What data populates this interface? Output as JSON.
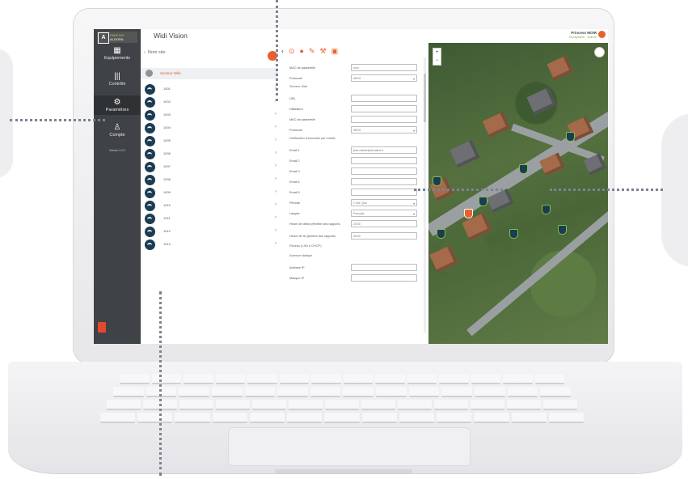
{
  "app": {
    "logo_mark": "A",
    "logo_line1": "PARKING",
    "logo_line2": "ALGORA",
    "title": "Widi Vision",
    "user_name": "Princess MOIR",
    "user_sub": "Infosystem · Admin",
    "version": "Version 2.0.2"
  },
  "nav": [
    {
      "label": "Equipements",
      "icon": "building-icon"
    },
    {
      "label": "Contrôle",
      "icon": "barcode-icon"
    },
    {
      "label": "Paramètres",
      "icon": "gear-icon"
    },
    {
      "label": "Compte",
      "icon": "user-icon"
    }
  ],
  "list": {
    "header": "Nom site",
    "group": "Secteur Wife",
    "items": [
      "1001",
      "1002",
      "1003",
      "1004",
      "1005",
      "1006",
      "1007",
      "1008",
      "1009",
      "1010",
      "1011",
      "1012",
      "1013"
    ]
  },
  "toolbar": [
    "‹",
    "⊙",
    "●",
    "✎",
    "⚒",
    "▣"
  ],
  "form": {
    "rows": [
      {
        "label": "MAC de passerelle",
        "value": "xxxx"
      },
      {
        "label": "Protocole",
        "value": "WISO",
        "select": true
      },
      {
        "section": "Serveur Web"
      },
      {
        "label": "URL",
        "value": ""
      },
      {
        "label": "Utilisateur",
        "value": ""
      },
      {
        "label": "MAC de passerelle",
        "value": ""
      },
      {
        "label": "Protocole",
        "value": "WISO",
        "select": true
      },
      {
        "section": "Notification d'anomalie par emails"
      },
      {
        "label": "Email 1",
        "value": "jean.martin@domaine.fr"
      },
      {
        "label": "Email 2",
        "value": ""
      },
      {
        "label": "Email 3",
        "value": ""
      },
      {
        "label": "Email 4",
        "value": ""
      },
      {
        "label": "Email 5",
        "value": ""
      },
      {
        "label": "Période",
        "value": "1 fois / jour",
        "select": true
      },
      {
        "label": "Langue",
        "value": "Français",
        "select": true
      },
      {
        "label": "Heure de début (fenêtre des rapports",
        "value": "23:00"
      },
      {
        "label": "Heure de fin (fenêtre des rapports",
        "value": "06:00"
      },
      {
        "section": "Réseau (LAN & DHCP)"
      },
      {
        "section": "Adresse statique"
      },
      {
        "label": "Adresse IP",
        "value": ""
      },
      {
        "label": "Masque IP",
        "value": ""
      }
    ]
  },
  "map": {
    "zoom_in": "+",
    "zoom_out": "−"
  },
  "colors": {
    "accent": "#e9602d",
    "sidebar": "#3f4246",
    "icon_dark": "#1c3c52",
    "map_green": "#7fc04a"
  }
}
